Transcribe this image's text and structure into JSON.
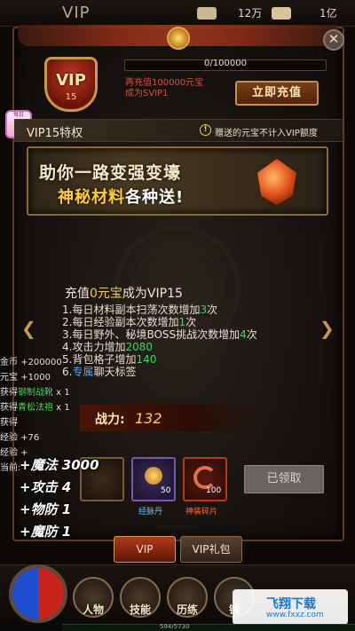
{
  "topbar": {
    "title": "VIP",
    "gold": "12万",
    "yuanbao": "1亿"
  },
  "vip": {
    "badge_text": "VIP",
    "level_text": "15",
    "progress_text": "0/100000",
    "progress_fraction": 0.0,
    "recharge_hint_line1": "再充值100000元宝",
    "recharge_hint_line2": "成为SVIP1",
    "recharge_button": "立即充值"
  },
  "pig_label": "每日",
  "privilege_header": {
    "title": "VIP15特权",
    "note": "赠送的元宝不计入VIP额度"
  },
  "banner": {
    "line1": "助你一路变强变壕",
    "line2_highlight": "神秘材料",
    "line2_rest": "各种送!"
  },
  "privileges": {
    "head_prefix": "充值",
    "head_amount": "0元宝",
    "head_suffix": "成为VIP15",
    "items": [
      {
        "pre": "1.每日材料副本扫荡次数增加",
        "num": "3",
        "post": "次"
      },
      {
        "pre": "2.每日经验副本次数增加",
        "num": "1",
        "post": "次"
      },
      {
        "pre": "3.每日野外、秘境BOSS挑战次数增加",
        "num": "4",
        "post": "次"
      },
      {
        "pre": "4.攻击力增加",
        "num": "2080",
        "post": ""
      },
      {
        "pre": "5.背包格子增加",
        "num": "140",
        "post": ""
      },
      {
        "pre": "6.",
        "special": "专属",
        "post": "聊天标签"
      }
    ]
  },
  "drops": [
    {
      "pre": "金币 ",
      "val": "+200000"
    },
    {
      "pre": "元宝 ",
      "val": "+1000"
    },
    {
      "pre": "获得",
      "green": "钢制战靴",
      "val": " x 1"
    },
    {
      "pre": "获得",
      "green": "青松法袍",
      "val": " x 1"
    },
    {
      "pre": "获得",
      "green": "",
      "val": ""
    },
    {
      "pre": "经验 +76",
      "green": "",
      "val": ""
    },
    {
      "pre": "经验 +",
      "green": "",
      "val": ""
    },
    {
      "pre": "当前:",
      "green": "",
      "val": ""
    }
  ],
  "power": {
    "label": "战力:",
    "value": "132"
  },
  "float_stats": [
    "+魔法 3000",
    "+攻击 4",
    "+物防 1",
    "+魔防 1"
  ],
  "rewards": [
    {
      "name": "",
      "qty": ""
    },
    {
      "name": "经脉丹",
      "qty": "50"
    },
    {
      "name": "神装碎片",
      "qty": "100"
    }
  ],
  "claimed_button": "已领取",
  "tabs": {
    "vip": "VIP",
    "gift": "VIP礼包"
  },
  "nav": [
    {
      "label": "人物"
    },
    {
      "label": "技能"
    },
    {
      "label": "历练"
    },
    {
      "label": "锻"
    }
  ],
  "watermark": {
    "title": "飞翔下载",
    "url": "www.fxxz.com"
  },
  "exp_text": "594/5730",
  "colors": {
    "accent_gold": "#f4c94a",
    "green": "#44d15c",
    "red_hint": "#e84a2a"
  }
}
